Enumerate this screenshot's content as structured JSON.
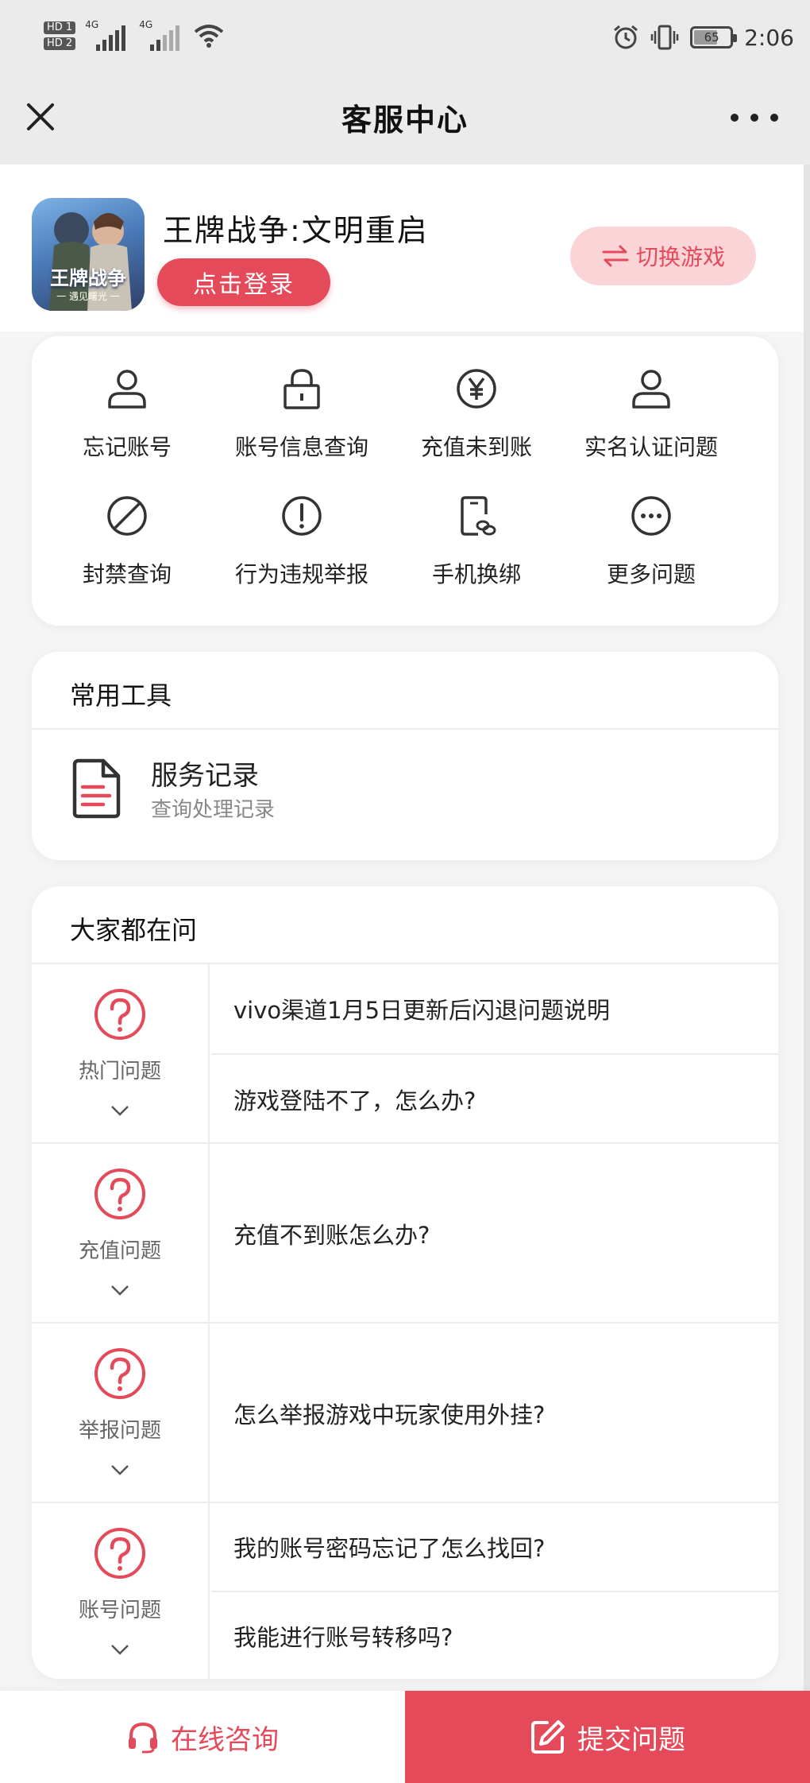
{
  "status_bar": {
    "sim1": "HD 1",
    "sim2": "HD 2",
    "network1": "4G",
    "network2": "4G",
    "battery": "65",
    "time": "2:06"
  },
  "title_bar": {
    "title": "客服中心"
  },
  "game": {
    "name": "王牌战争:文明重启",
    "icon_text": "王牌战争",
    "icon_subtext": "一 遇见曙光 一",
    "login_label": "点击登录",
    "switch_label": "切换游戏"
  },
  "quick_actions": [
    {
      "label": "忘记账号",
      "icon": "user-icon"
    },
    {
      "label": "账号信息查询",
      "icon": "lock-icon"
    },
    {
      "label": "充值未到账",
      "icon": "yen-icon"
    },
    {
      "label": "实名认证问题",
      "icon": "user-icon"
    },
    {
      "label": "封禁查询",
      "icon": "ban-icon"
    },
    {
      "label": "行为违规举报",
      "icon": "alert-icon"
    },
    {
      "label": "手机换绑",
      "icon": "phone-link-icon"
    },
    {
      "label": "更多问题",
      "icon": "more-circle-icon"
    }
  ],
  "tools": {
    "title": "常用工具",
    "item_title": "服务记录",
    "item_subtitle": "查询处理记录"
  },
  "faq": {
    "title": "大家都在问",
    "groups": [
      {
        "category": "热门问题",
        "questions": [
          "vivo渠道1月5日更新后闪退问题说明",
          "游戏登陆不了，怎么办?"
        ]
      },
      {
        "category": "充值问题",
        "questions": [
          "充值不到账怎么办?"
        ]
      },
      {
        "category": "举报问题",
        "questions": [
          "怎么举报游戏中玩家使用外挂?"
        ]
      },
      {
        "category": "账号问题",
        "questions": [
          "我的账号密码忘记了怎么找回?",
          "我能进行账号转移吗?"
        ]
      }
    ]
  },
  "bottom_bar": {
    "online_label": "在线咨询",
    "submit_label": "提交问题"
  },
  "colors": {
    "accent": "#e44a5a",
    "accent_light": "#fbd4d8",
    "background": "#f5f5f5",
    "header_gray": "#ebebeb"
  }
}
